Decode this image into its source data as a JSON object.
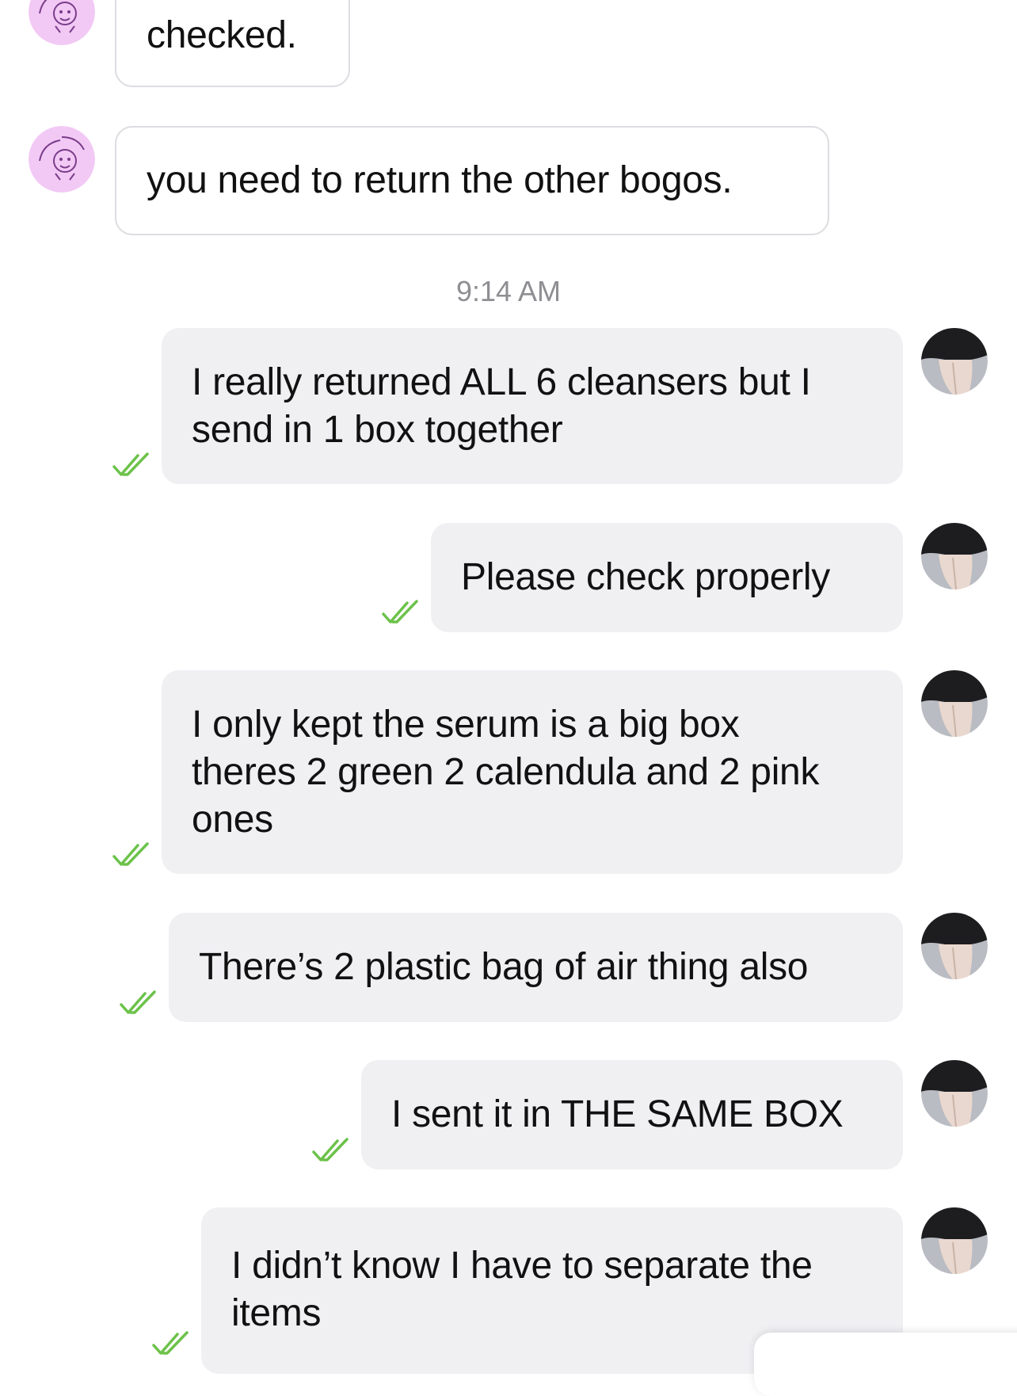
{
  "conversation": {
    "timestamp": "9:14 AM",
    "incoming": [
      {
        "text": "checked."
      },
      {
        "text": "you need to return the other bogos."
      }
    ],
    "outgoing": [
      {
        "lines": [
          "I really returned ALL 6 cleansers but I",
          "send in 1 box together"
        ]
      },
      {
        "lines": [
          "Please check properly"
        ]
      },
      {
        "lines": [
          "I only kept the serum is a big box",
          "theres 2 green 2 calendula and 2 pink",
          "ones"
        ]
      },
      {
        "lines": [
          "There’s 2 plastic bag of air thing also"
        ]
      },
      {
        "lines": [
          "I sent it in THE SAME BOX"
        ]
      },
      {
        "lines": [
          "I didn’t know I have to separate the",
          "items"
        ]
      }
    ]
  },
  "icons": {
    "seller_avatar": "angel-havens-logo-avatar",
    "user_avatar": "user-profile-avatar",
    "read_receipt": "double-check-icon"
  },
  "colors": {
    "incoming_bubble_bg": "#ffffff",
    "incoming_bubble_border": "#dddde2",
    "outgoing_bubble_bg": "#f0f0f3",
    "read_receipt": "#6cc24a",
    "timestamp_text": "#8e8e93",
    "seller_avatar_bg": "#f2c9f5"
  }
}
